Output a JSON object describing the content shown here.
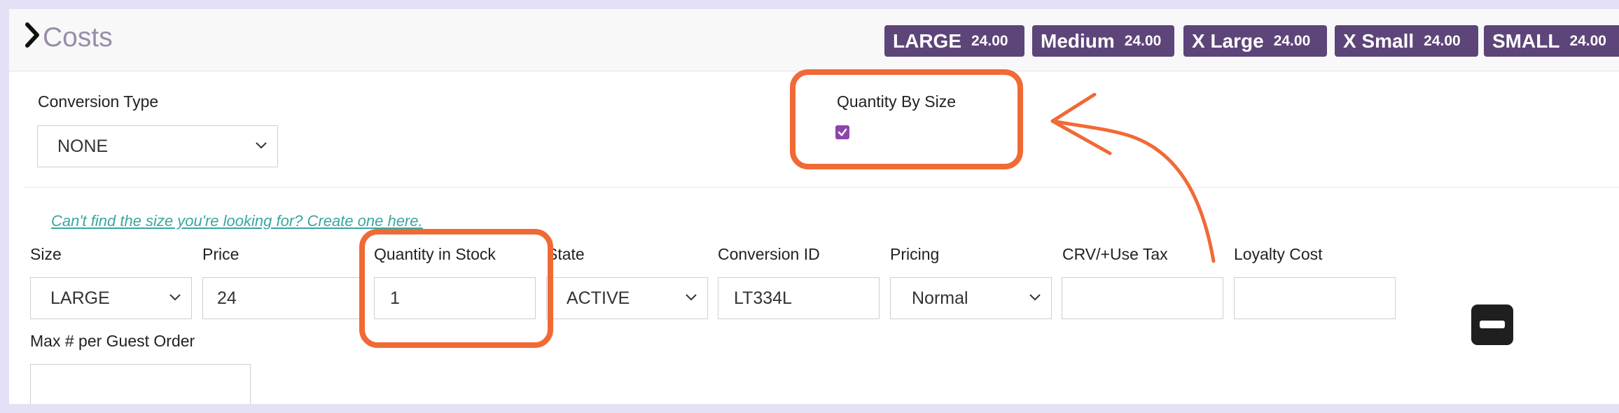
{
  "header": {
    "title": "Costs",
    "badges": [
      {
        "size": "LARGE",
        "price": "24.00"
      },
      {
        "size": "Medium",
        "price": "24.00"
      },
      {
        "size": "X Large",
        "price": "24.00"
      },
      {
        "size": "X Small",
        "price": "24.00"
      },
      {
        "size": "SMALL",
        "price": "24.00"
      }
    ]
  },
  "conversion_type": {
    "label": "Conversion Type",
    "value": "NONE"
  },
  "quantity_by_size": {
    "label": "Quantity By Size",
    "checked": true
  },
  "create_size_link": "Can't find the size you're looking for? Create one here.",
  "fields": {
    "size": {
      "label": "Size",
      "value": "LARGE"
    },
    "price": {
      "label": "Price",
      "value": "24"
    },
    "quantity": {
      "label": "Quantity in Stock",
      "value": "1"
    },
    "state": {
      "label": "State",
      "value": "ACTIVE"
    },
    "conversion_id": {
      "label": "Conversion ID",
      "value": "LT334L"
    },
    "pricing": {
      "label": "Pricing",
      "value": "Normal"
    },
    "crv": {
      "label": "CRV/+Use Tax",
      "value": ""
    },
    "loyalty": {
      "label": "Loyalty Cost",
      "value": ""
    },
    "max_per_order": {
      "label": "Max # per Guest Order",
      "value": ""
    }
  },
  "colors": {
    "accent": "#5d4479",
    "highlight": "#f06a35",
    "link": "#3aa6a0",
    "checkbox": "#8e44ad"
  }
}
